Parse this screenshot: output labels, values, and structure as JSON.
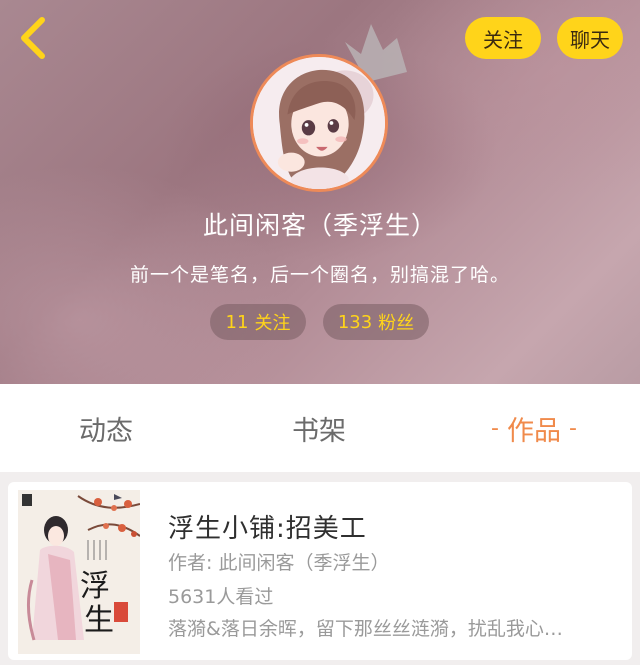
{
  "header": {
    "back_icon": "chevron-left-icon",
    "follow_label": "关注",
    "chat_label": "聊天",
    "username": "此间闲客（季浮生）",
    "bio": "前一个是笔名，后一个圈名，别搞混了哈。",
    "stats": {
      "following_count": "11",
      "following_label": "关注",
      "fans_count": "133",
      "fans_label": "粉丝"
    },
    "colors": {
      "accent": "#ffd41a",
      "avatar_ring": "#ee8a58"
    }
  },
  "tabs": {
    "dynamics": "动态",
    "shelf": "书架",
    "works": "作品",
    "active": "works",
    "active_color": "#f08a4b"
  },
  "works": [
    {
      "title": "浮生小铺:招美工",
      "author": "作者: 此间闲客（季浮生）",
      "views": "5631人看过",
      "description": "落漪&落日余晖，留下那丝丝涟漪，扰乱我心…"
    }
  ]
}
